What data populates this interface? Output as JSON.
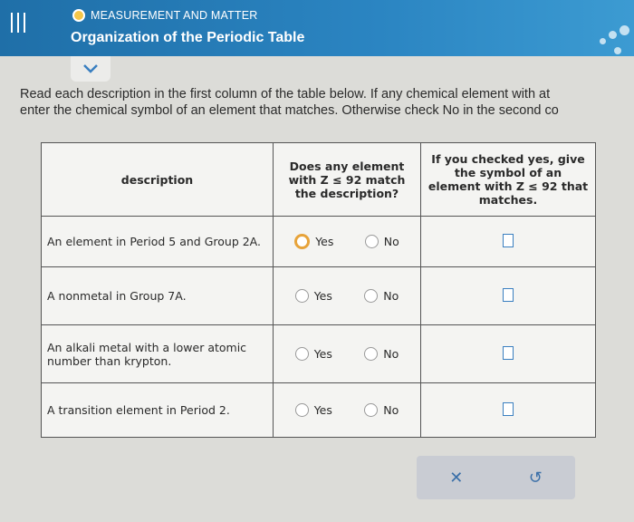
{
  "header": {
    "topic": "MEASUREMENT AND MATTER",
    "title": "Organization of the Periodic Table"
  },
  "instructions": {
    "line1": "Read each description in the first column of the table below. If any chemical element with at",
    "line2": "enter the chemical symbol of an element that matches. Otherwise check No in the second co"
  },
  "table": {
    "headers": {
      "description": "description",
      "match": "Does any element with Z ≤ 92 match the description?",
      "symbol": "If you checked yes, give the symbol of an element with Z ≤ 92 that matches."
    },
    "rows": [
      {
        "description": "An element in Period 5 and Group 2A.",
        "yes": "Yes",
        "no": "No"
      },
      {
        "description": "A nonmetal in Group 7A.",
        "yes": "Yes",
        "no": "No"
      },
      {
        "description": "An alkali metal with a lower atomic number than krypton.",
        "yes": "Yes",
        "no": "No"
      },
      {
        "description": "A transition element in Period 2.",
        "yes": "Yes",
        "no": "No"
      }
    ]
  },
  "actions": {
    "clear": "✕",
    "undo": "↺"
  }
}
